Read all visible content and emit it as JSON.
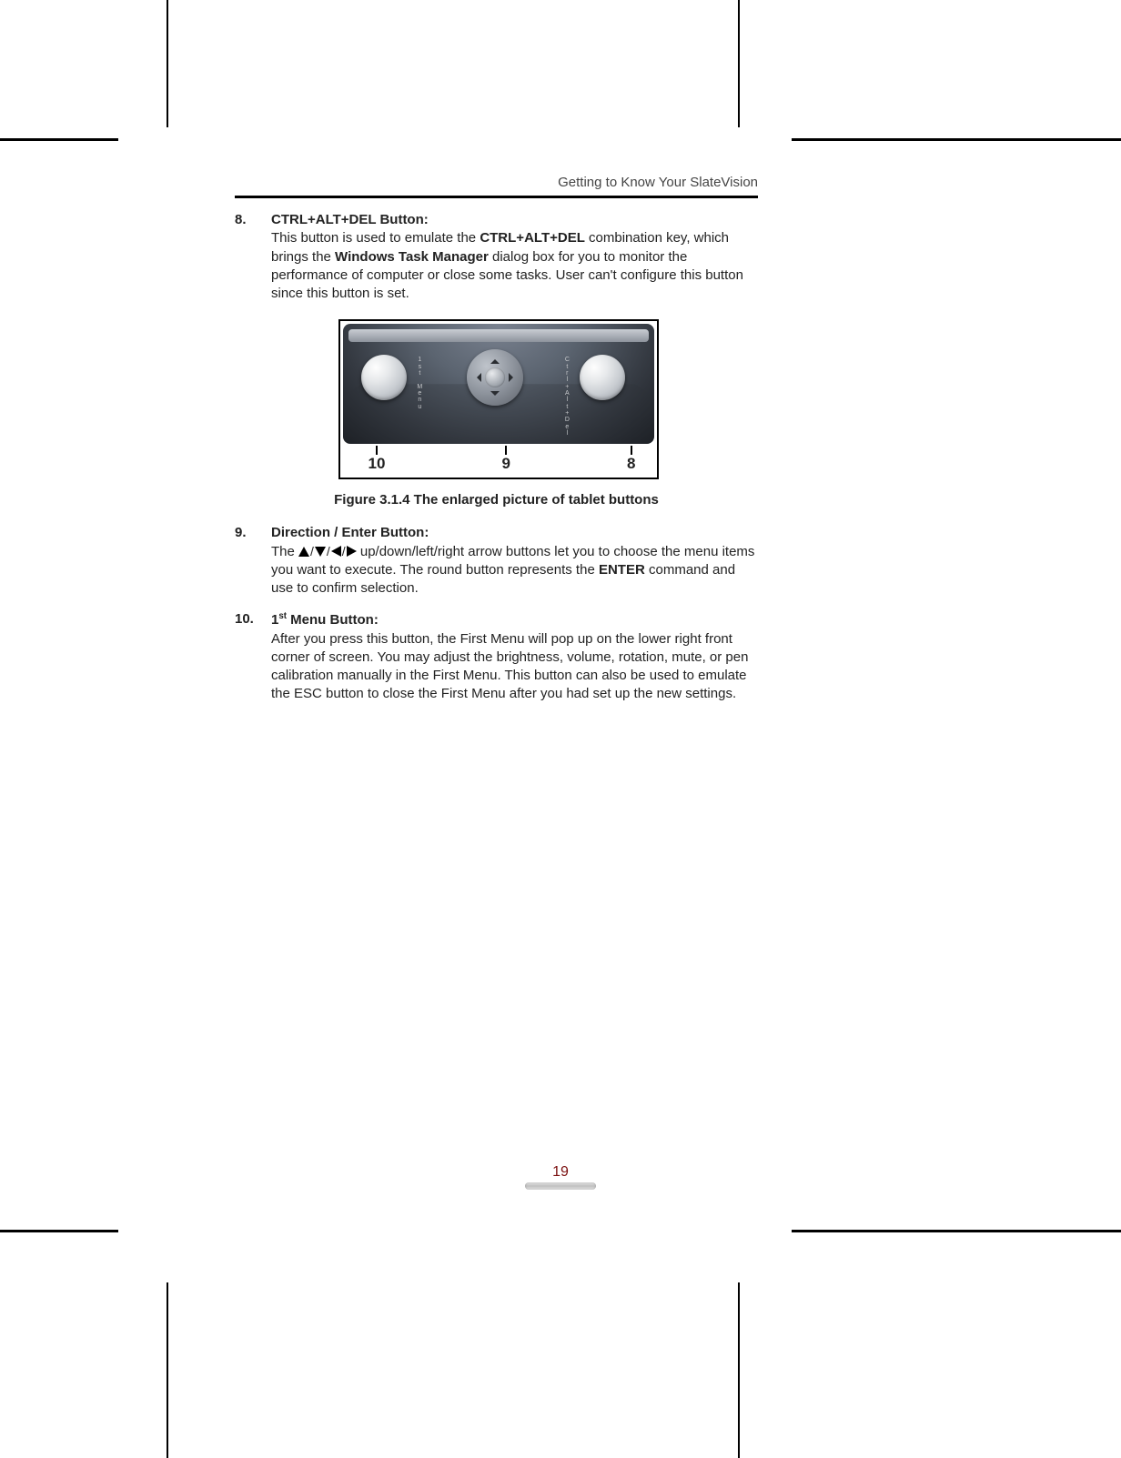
{
  "header": {
    "title": "Getting to Know Your SlateVision"
  },
  "items": {
    "8": {
      "num": "8.",
      "title": "CTRL+ALT+DEL Button:",
      "text_a": "This button is used to emulate the ",
      "bold_a": "CTRL+ALT+DEL",
      "text_b": " combination key, which brings the ",
      "bold_b": "Windows Task Manager",
      "text_c": " dialog box for you to monitor the performance of computer or close some tasks. User can't configure this button since this button is set."
    },
    "9": {
      "num": "9.",
      "title": "Direction / Enter Button:",
      "lead": "The ",
      "mid": " up/down/left/right arrow buttons let you to choose the menu items you want to execute. The round button represents the ",
      "bold": "ENTER",
      "tail": " command and use to confirm selection."
    },
    "10": {
      "num": "10.",
      "title_pre": "1",
      "title_sup": "st",
      "title_post": " Menu Button:",
      "text": "After you press this button, the First Menu will pop up on the lower right front corner of screen. You may adjust the brightness, volume, rotation, mute, or pen calibration manually in the First Menu. This button can also be used to emulate the ESC button to close the First Menu after you had set up the new settings."
    }
  },
  "figure": {
    "caption": "Figure 3.1.4 The enlarged picture of tablet buttons",
    "callouts": [
      "10",
      "9",
      "8"
    ],
    "labels": {
      "left": "1st Menu",
      "right": "Ctrl+Alt+Del"
    }
  },
  "page_number": "19"
}
